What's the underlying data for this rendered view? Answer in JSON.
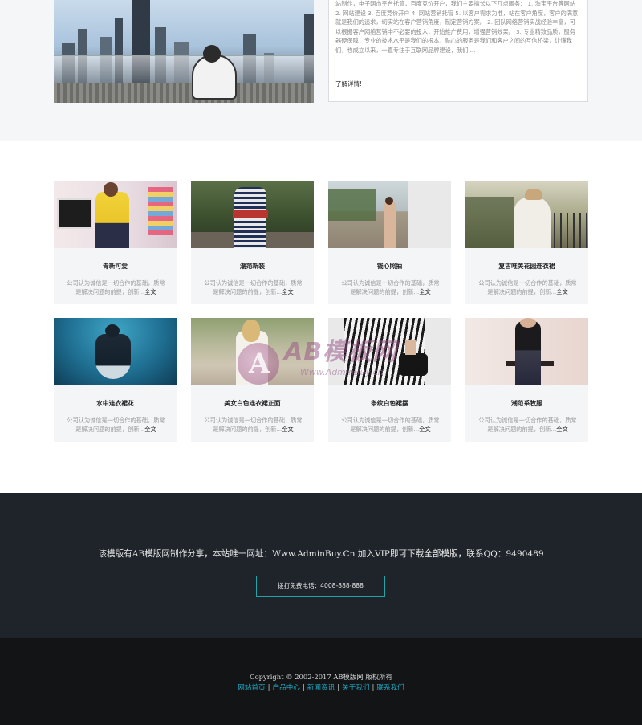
{
  "about": {
    "text": "站制作，电子网市平台托管，百度竞价开户，我们主要擅长以下几点服务： 1. 淘宝平台等网站 2. 网站建设 3. 百度竞价开户 4. 网站营销托管 5. 以客户需求为准，站在客户角度，客户的满意就是我们的追求，切实站在客户营销角度，制定营销方案。 2. 团队网络营销实战经验丰富，可以根据客户网络营销中不必要的投入，开始推广费用，增强营销效果。 3. 专业精致品质，服务器硬保障，专业的技术水平是我们的根本，贴心的服务是我们和客户之间的互信桥梁，让懂我们，也成立以来，一直专注于互联网品牌建设，我们 ...",
    "more_label": "了解详情!"
  },
  "products": [
    {
      "title": "青新可爱",
      "desc": "公司认为诚信是一切合作的基础，质常是解决问题的前提，创新...",
      "more": "全文"
    },
    {
      "title": "潮范新装",
      "desc": "公司认为诚信是一切合作的基础，质常是解决问题的前提，创新...",
      "more": "全文"
    },
    {
      "title": "钱心照抽",
      "desc": "公司认为诚信是一切合作的基础，质常是解决问题的前提，创新...",
      "more": "全文"
    },
    {
      "title": "复古唯美花园连衣裙",
      "desc": "公司认为诚信是一切合作的基础，质常是解决问题的前提，创新...",
      "more": "全文"
    },
    {
      "title": "水中连衣裙花",
      "desc": "公司认为诚信是一切合作的基础，质常是解决问题的前提，创新...",
      "more": "全文"
    },
    {
      "title": "美女白色连衣裙正面",
      "desc": "公司认为诚信是一切合作的基础，质常是解决问题的前提，创新...",
      "more": "全文"
    },
    {
      "title": "条纹白色裙摆",
      "desc": "公司认为诚信是一切合作的基础，质常是解决问题的前提，创新...",
      "more": "全文"
    },
    {
      "title": "潮范系牧服",
      "desc": "公司认为诚信是一切合作的基础，质常是解决问题的前提，创新...",
      "more": "全文"
    }
  ],
  "watermark": {
    "title": "AB模板网",
    "url": "Www.AdminBuy.cn",
    "letter": "A"
  },
  "cta": {
    "text": "该模版有AB模版网制作分享，本站唯一网址：Www.AdminBuy.Cn 加入VIP即可下载全部模版，联系QQ：9490489",
    "button_label": "拨打免费电话：4008-888-888"
  },
  "footer": {
    "copyright": "Copyright © 2002-2017 AB模版网 版权所有",
    "links": [
      "网站首页",
      "产品中心",
      "新闻资讯",
      "关于我们",
      "联系我们"
    ]
  },
  "colors": {
    "accent": "#23a4a6",
    "link": "#21a9c4",
    "dark_band": "#1e242a",
    "footer_bg": "#121416"
  }
}
